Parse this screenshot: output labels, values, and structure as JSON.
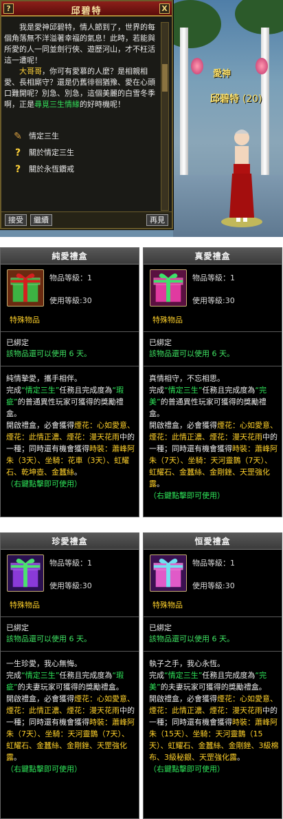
{
  "npc_window": {
    "title": "邱碧特",
    "help_icon": "?",
    "close_icon": "X",
    "para1": "我是愛神邱碧特，情人節到了，世界的每個角落無不洋溢著幸福的氣息！此時，若能與所愛的人一同並劍行俠、遊歷河山，才不枉活這一遭呢！",
    "para2_lead": "大哥哥",
    "para2_a": "，你可有愛慕的人麼？是相親相愛、長相廝守？還是仍舊徘徊猶豫、愛在心頭口難開呢？別急、別急，這個美麗的白雪冬季啊，正是",
    "para2_hl": "尋覓三生情緣",
    "para2_b": "的好時機呢！",
    "options": [
      {
        "icon": "scroll-icon",
        "label": "情定三生"
      },
      {
        "icon": "question-icon",
        "label": "關於情定三生"
      },
      {
        "icon": "question-icon",
        "label": "關於永恆鑽戒"
      }
    ],
    "buttons": {
      "accept": "接受",
      "continue": "繼續",
      "goodbye": "再見"
    }
  },
  "npc_scene": {
    "title": "愛神",
    "name": "邱碧特",
    "level": "(20)"
  },
  "cards": [
    {
      "title": "純愛禮盒",
      "item_level": "物品等級：1",
      "use_level": "使用等級:30",
      "special": "特殊物品",
      "bound": "已綁定",
      "days": "該物品還可以使用 6 天。",
      "d1": "純情摯愛，攜手相伴。",
      "d2a": "完成",
      "d2q": "“情定三生”",
      "d2b": "任務且完成度為",
      "d2r": "“瑕疵”",
      "d2c": "的普通異性玩家可獲得的獎勵禮盒。",
      "d3a": "開啟禮盒，必會獲得",
      "d3f": "煙花：心如愛意、煙花：此情正濃、煙花：漫天花雨",
      "d3b": "中的一種；同時還有機會獲得",
      "d3p": "時裝：蕭峰阿朱（3天）、坐騎：花車（3天）、虹耀石、乾坤壺、金蠶絲",
      "d3c": "。",
      "rc": "（右鍵點擊即可使用）",
      "gift_color": "#3db243",
      "ribbon_color": "#d41f1f",
      "bg": "#6a2a10"
    },
    {
      "title": "真愛禮盒",
      "item_level": "物品等級：1",
      "use_level": "使用等級:30",
      "special": "特殊物品",
      "bound": "已綁定",
      "days": "該物品還可以使用 6 天。",
      "d1": "真情相守，不忘相思。",
      "d2a": "完成",
      "d2q": "“情定三生”",
      "d2b": "任務且完成度為",
      "d2r": "“完美”",
      "d2c": "的普通異性玩家可獲得的獎勵禮盒。",
      "d3a": "開啟禮盒，必會獲得",
      "d3f": "煙花：心如愛意、煙花：此情正濃、煙花：漫天花雨",
      "d3b": "中的一種；同時還有機會獲得",
      "d3p": "時裝：蕭峰阿朱（7天）、坐騎：天河靈鵲（7天）、虹耀石、金蠶絲、金剛銼、天罡強化露",
      "d3c": "。",
      "rc": "（右鍵點擊即可使用）",
      "gift_color": "#e03aa0",
      "ribbon_color": "#3ee06a",
      "bg": "#5a1040"
    },
    {
      "title": "珍愛禮盒",
      "item_level": "物品等級：1",
      "use_level": "使用等級:30",
      "special": "特殊物品",
      "bound": "已綁定",
      "days": "該物品還可以使用 6 天。",
      "d1": "一生珍愛，我心無悔。",
      "d2a": "完成",
      "d2q": "“情定三生”",
      "d2b": "任務且完成度為",
      "d2r": "“瑕疵”",
      "d2c": "的夫妻玩家可獲得的獎勵禮盒。",
      "d3a": "開啟禮盒，必會獲得",
      "d3f": "煙花：心如愛意、煙花：此情正濃、煙花：漫天花雨",
      "d3b": "中的一種；同時還有機會獲得",
      "d3p": "時裝：蕭峰阿朱（7天）、坐騎：天河靈鵲（7天）、虹耀石、金蠶絲、金剛銼、天罡強化露",
      "d3c": "。",
      "rc": "（右鍵點擊即可使用）",
      "gift_color": "#8a3ad8",
      "ribbon_color": "#4be36f",
      "bg": "#2a1050"
    },
    {
      "title": "恒愛禮盒",
      "item_level": "物品等級：1",
      "use_level": "使用等級:30",
      "special": "特殊物品",
      "bound": "已綁定",
      "days": "該物品還可以使用 6 天。",
      "d1": "執子之手，我心永恆。",
      "d2a": "完成",
      "d2q": "“情定三生”",
      "d2b": "任務且完成度為",
      "d2r": "“完美”",
      "d2c": "的夫妻玩家可獲得的獎勵禮盒。",
      "d3a": "開啟禮盒，必會獲得",
      "d3f": "煙花：心如愛意、煙花：此情正濃、煙花：漫天花雨",
      "d3b": "中的一種；同時還有機會獲得",
      "d3p": "時裝：蕭峰阿朱（15天）、坐騎：天河靈鵲（15天）、虹耀石、金蠶絲、金剛銼、3級棉布、3級秘銀、天罡強化露",
      "d3c": "。",
      "rc": "（右鍵點擊即可使用）",
      "gift_color": "#e05ac8",
      "ribbon_color": "#6fe3f0",
      "bg": "#3a1050"
    }
  ]
}
